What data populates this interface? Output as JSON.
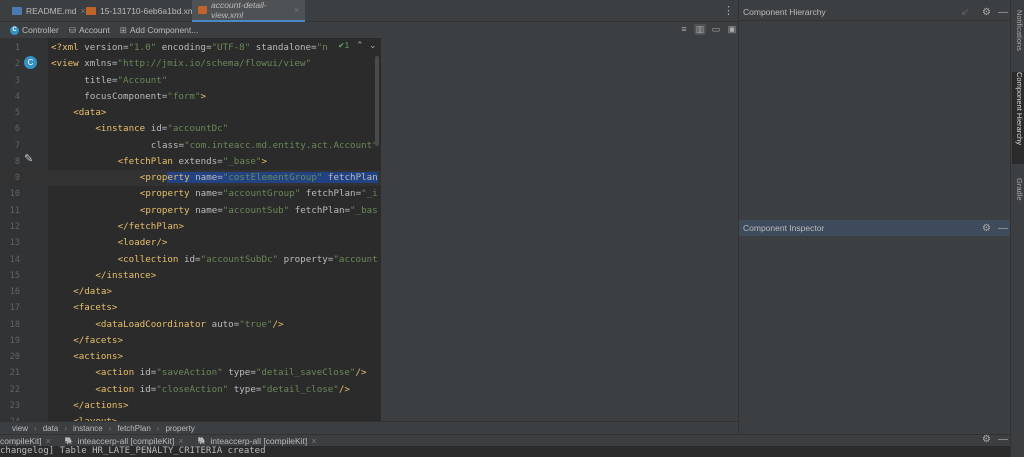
{
  "tabs": [
    {
      "label": "README.md",
      "icon": "markdown-file-icon",
      "active": false
    },
    {
      "label": "15-131710-6eb6a1bd.xml",
      "icon": "xml-file-icon",
      "active": false
    },
    {
      "label": "account-detail-view.xml",
      "icon": "xml-file-icon",
      "active": true
    }
  ],
  "toolbar": {
    "controller": "Controller",
    "account": "Account",
    "add_component": "Add Component..."
  },
  "editor": {
    "inspection": "✔1",
    "lines": [
      {
        "n": "1",
        "i": 0,
        "h": [
          [
            "t",
            "<?xml "
          ],
          [
            "a",
            "version"
          ],
          [
            "a",
            "="
          ],
          [
            "s",
            "\"1.0\""
          ],
          [
            "a",
            " encoding"
          ],
          [
            "a",
            "="
          ],
          [
            "s",
            "\"UTF-8\""
          ],
          [
            "a",
            " standalone"
          ],
          [
            "a",
            "="
          ],
          [
            "s",
            "\"n"
          ]
        ]
      },
      {
        "n": "2",
        "i": 0,
        "h": [
          [
            "t",
            "<view "
          ],
          [
            "a",
            "xmlns="
          ],
          [
            "s",
            "\"http://jmix.io/schema/flowui/view\""
          ]
        ]
      },
      {
        "n": "3",
        "i": 6,
        "h": [
          [
            "a",
            "title="
          ],
          [
            "s",
            "\"Account\""
          ]
        ]
      },
      {
        "n": "4",
        "i": 6,
        "h": [
          [
            "a",
            "focusComponent="
          ],
          [
            "s",
            "\"form\""
          ],
          [
            "t",
            ">"
          ]
        ]
      },
      {
        "n": "5",
        "i": 4,
        "h": [
          [
            "t",
            "<data>"
          ]
        ]
      },
      {
        "n": "6",
        "i": 8,
        "h": [
          [
            "t",
            "<instance "
          ],
          [
            "a",
            "id="
          ],
          [
            "s",
            "\"accountDc\""
          ]
        ]
      },
      {
        "n": "7",
        "i": 18,
        "h": [
          [
            "a",
            "class="
          ],
          [
            "s",
            "\"com.inteacc.md.entity.act.Account\""
          ]
        ]
      },
      {
        "n": "8",
        "i": 12,
        "h": [
          [
            "t",
            "<fetchPlan "
          ],
          [
            "a",
            "extends="
          ],
          [
            "s",
            "\"_base\""
          ],
          [
            "t",
            ">"
          ]
        ]
      },
      {
        "n": "9",
        "i": 16,
        "h": [
          [
            "t",
            "<prop"
          ],
          [
            "t sel",
            "erty"
          ],
          [
            "a sel",
            " name="
          ],
          [
            "s sel",
            "\"costElementGroup\""
          ],
          [
            "a sel",
            " fetchPlan"
          ]
        ]
      },
      {
        "n": "10",
        "i": 16,
        "h": [
          [
            "t",
            "<property "
          ],
          [
            "a",
            "name="
          ],
          [
            "s",
            "\"accountGroup\""
          ],
          [
            "a",
            " fetchPlan="
          ],
          [
            "s",
            "\"_i"
          ]
        ]
      },
      {
        "n": "11",
        "i": 16,
        "h": [
          [
            "t",
            "<property "
          ],
          [
            "a",
            "name="
          ],
          [
            "s",
            "\"accountSub\""
          ],
          [
            "a",
            " fetchPlan="
          ],
          [
            "s",
            "\"_bas"
          ]
        ]
      },
      {
        "n": "12",
        "i": 12,
        "h": [
          [
            "t",
            "</fetchPlan>"
          ]
        ]
      },
      {
        "n": "13",
        "i": 12,
        "h": [
          [
            "t",
            "<loader/>"
          ]
        ]
      },
      {
        "n": "14",
        "i": 12,
        "h": [
          [
            "t",
            "<collection "
          ],
          [
            "a",
            "id="
          ],
          [
            "s",
            "\"accountSubDc\""
          ],
          [
            "a",
            " property="
          ],
          [
            "s",
            "\"account"
          ]
        ]
      },
      {
        "n": "15",
        "i": 8,
        "h": [
          [
            "t",
            "</instance>"
          ]
        ]
      },
      {
        "n": "16",
        "i": 4,
        "h": [
          [
            "t",
            "</data>"
          ]
        ]
      },
      {
        "n": "17",
        "i": 4,
        "h": [
          [
            "t",
            "<facets>"
          ]
        ]
      },
      {
        "n": "18",
        "i": 8,
        "h": [
          [
            "t",
            "<dataLoadCoordinator "
          ],
          [
            "a",
            "auto="
          ],
          [
            "s",
            "\"true\""
          ],
          [
            "t",
            "/>"
          ]
        ]
      },
      {
        "n": "19",
        "i": 4,
        "h": [
          [
            "t",
            "</facets>"
          ]
        ]
      },
      {
        "n": "20",
        "i": 4,
        "h": [
          [
            "t",
            "<actions>"
          ]
        ]
      },
      {
        "n": "21",
        "i": 8,
        "h": [
          [
            "t",
            "<action "
          ],
          [
            "a",
            "id="
          ],
          [
            "s",
            "\"saveAction\""
          ],
          [
            "a",
            " type="
          ],
          [
            "s",
            "\"detail_saveClose\""
          ],
          [
            "t",
            "/>"
          ]
        ]
      },
      {
        "n": "22",
        "i": 8,
        "h": [
          [
            "t",
            "<action "
          ],
          [
            "a",
            "id="
          ],
          [
            "s",
            "\"closeAction\""
          ],
          [
            "a",
            " type="
          ],
          [
            "s",
            "\"detail_close\""
          ],
          [
            "t",
            "/>"
          ]
        ]
      },
      {
        "n": "23",
        "i": 4,
        "h": [
          [
            "t",
            "</actions>"
          ]
        ]
      },
      {
        "n": "24",
        "i": 4,
        "h": [
          [
            "t",
            "<layout>"
          ]
        ]
      }
    ]
  },
  "breadcrumb": [
    "view",
    "data",
    "instance",
    "fetchPlan",
    "property"
  ],
  "bottom_tabs": [
    "compileKit]",
    "inteaccerp-all [compileKit]",
    "inteaccerp-all [compileKit]"
  ],
  "console": "changelog] Table HR_LATE_PENALTY_CRITERIA created",
  "right_panel": {
    "hierarchy_title": "Component Hierarchy",
    "inspector_title": "Component Inspector"
  },
  "side_strip": [
    "Notifications",
    "Component Hierarchy",
    "Gradle"
  ]
}
